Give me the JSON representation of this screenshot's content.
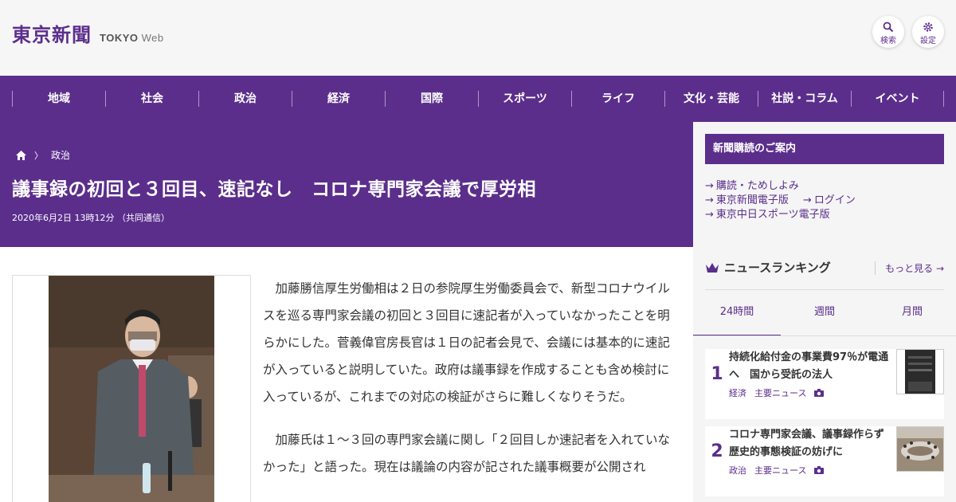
{
  "header": {
    "logo_jp": "東京新聞",
    "logo_en": "TOKYO",
    "logo_web": "Web",
    "search_label": "検索",
    "settings_label": "設定"
  },
  "nav": {
    "items": [
      "地域",
      "社会",
      "政治",
      "経済",
      "国際",
      "スポーツ",
      "ライフ",
      "文化・芸能",
      "社説・コラム",
      "イベント"
    ]
  },
  "breadcrumb": {
    "home_icon": "home-icon",
    "separator": "〉",
    "category": "政治"
  },
  "article": {
    "headline": "議事録の初回と３回目、速記なし　コロナ専門家会議で厚労相",
    "dateline": "2020年6月2日 13時12分 （共同通信）",
    "paragraphs": [
      "加藤勝信厚生労働相は２日の参院厚生労働委員会で、新型コロナウイルスを巡る専門家会議の初回と３回目に速記者が入っていなかったことを明らかにした。菅義偉官房長官は１日の記者会見で、会議には基本的に速記が入っていると説明していた。政府は議事録を作成することも含め検討に入っているが、これまでの対応の検証がさらに難しくなりそうだ。",
      "加藤氏は１～３回の専門家会議に関し「２回目しか速記者を入れていなかった」と語った。現在は議論の内容が記された議事概要が公開され"
    ]
  },
  "sidebar": {
    "subscribe": {
      "title": "新聞購読のご案内",
      "links": [
        "購読・ためしよみ",
        "東京新聞電子版",
        "ログイン",
        "東京中日スポーツ電子版"
      ]
    },
    "ranking": {
      "title": "ニュースランキング",
      "more": "もっと見る",
      "tabs": [
        "24時間",
        "週間",
        "月間"
      ],
      "items": [
        {
          "rank": "1",
          "title": "持続化給付金の事業費97％が電通へ　国から受託の法人",
          "category": "経済",
          "tag": "主要ニュース"
        },
        {
          "rank": "2",
          "title": "コロナ専門家会議、議事録作らず　歴史的事態検証の妨げに",
          "category": "政治",
          "tag": "主要ニュース"
        }
      ]
    }
  },
  "colors": {
    "brand": "#5b2e8c",
    "header_bg": "#f6f6f6",
    "sidebar_bg": "#f5f5f5"
  }
}
